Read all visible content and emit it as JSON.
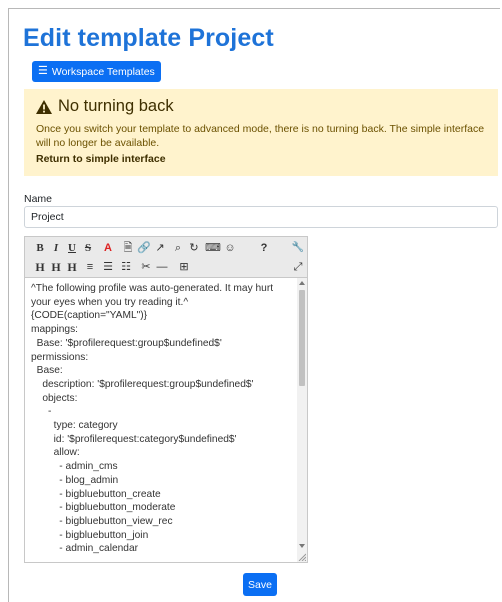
{
  "page": {
    "title": "Edit template Project",
    "workspace_templates_label": "Workspace Templates"
  },
  "alert": {
    "title": "No turning back",
    "body": "Once you switch your template to advanced mode, there is no turning back. The simple interface will no longer be available.",
    "link": "Return to simple interface"
  },
  "form": {
    "name_label": "Name",
    "name_value": "Project",
    "save_label": "Save"
  },
  "toolbar": {
    "row1": [
      {
        "name": "bold-button",
        "glyph": "B"
      },
      {
        "name": "italic-button",
        "glyph": "I"
      },
      {
        "name": "underline-button",
        "glyph": "U"
      },
      {
        "name": "strikethrough-button",
        "glyph": "S"
      },
      {
        "name": "text-color-button",
        "glyph": "A"
      },
      {
        "name": "insert-file-icon",
        "glyph": "🗎"
      },
      {
        "name": "link-icon",
        "glyph": "🔗"
      },
      {
        "name": "edit-link-icon",
        "glyph": "↗"
      },
      {
        "name": "find-icon",
        "glyph": "⌕"
      },
      {
        "name": "redo-icon",
        "glyph": "↻"
      },
      {
        "name": "keyboard-icon",
        "glyph": "⌨"
      },
      {
        "name": "smiley-icon",
        "glyph": "☺"
      },
      {
        "name": "help-icon",
        "glyph": "?"
      },
      {
        "name": "wrench-icon",
        "glyph": "🔧"
      }
    ],
    "row2": [
      {
        "name": "heading1-button",
        "glyph": "H"
      },
      {
        "name": "heading2-button",
        "glyph": "H"
      },
      {
        "name": "heading3-button",
        "glyph": "H"
      },
      {
        "name": "align-center-button",
        "glyph": "≡"
      },
      {
        "name": "bullet-list-button",
        "glyph": "☰"
      },
      {
        "name": "numbered-list-button",
        "glyph": "☷"
      },
      {
        "name": "cut-icon",
        "glyph": "✂"
      },
      {
        "name": "horizontal-rule-button",
        "glyph": "—"
      },
      {
        "name": "table-icon",
        "glyph": "⊞"
      },
      {
        "name": "fullscreen-icon",
        "glyph": "⤢"
      }
    ]
  },
  "editor": {
    "lines": [
      "^The following profile was auto-generated. It may hurt your eyes when you try reading it.^",
      "{CODE(caption=\"YAML\")}",
      "mappings:",
      "  Base: '$profilerequest:group$undefined$'",
      "permissions:",
      "  Base:",
      "    description: '$profilerequest:group$undefined$'",
      "    objects:",
      "      -",
      "        type: category",
      "        id: '$profilerequest:category$undefined$'",
      "        allow:",
      "          - admin_cms",
      "          - blog_admin",
      "          - bigbluebutton_create",
      "          - bigbluebutton_moderate",
      "          - bigbluebutton_view_rec",
      "          - bigbluebutton_join",
      "          - admin_calendar"
    ]
  }
}
